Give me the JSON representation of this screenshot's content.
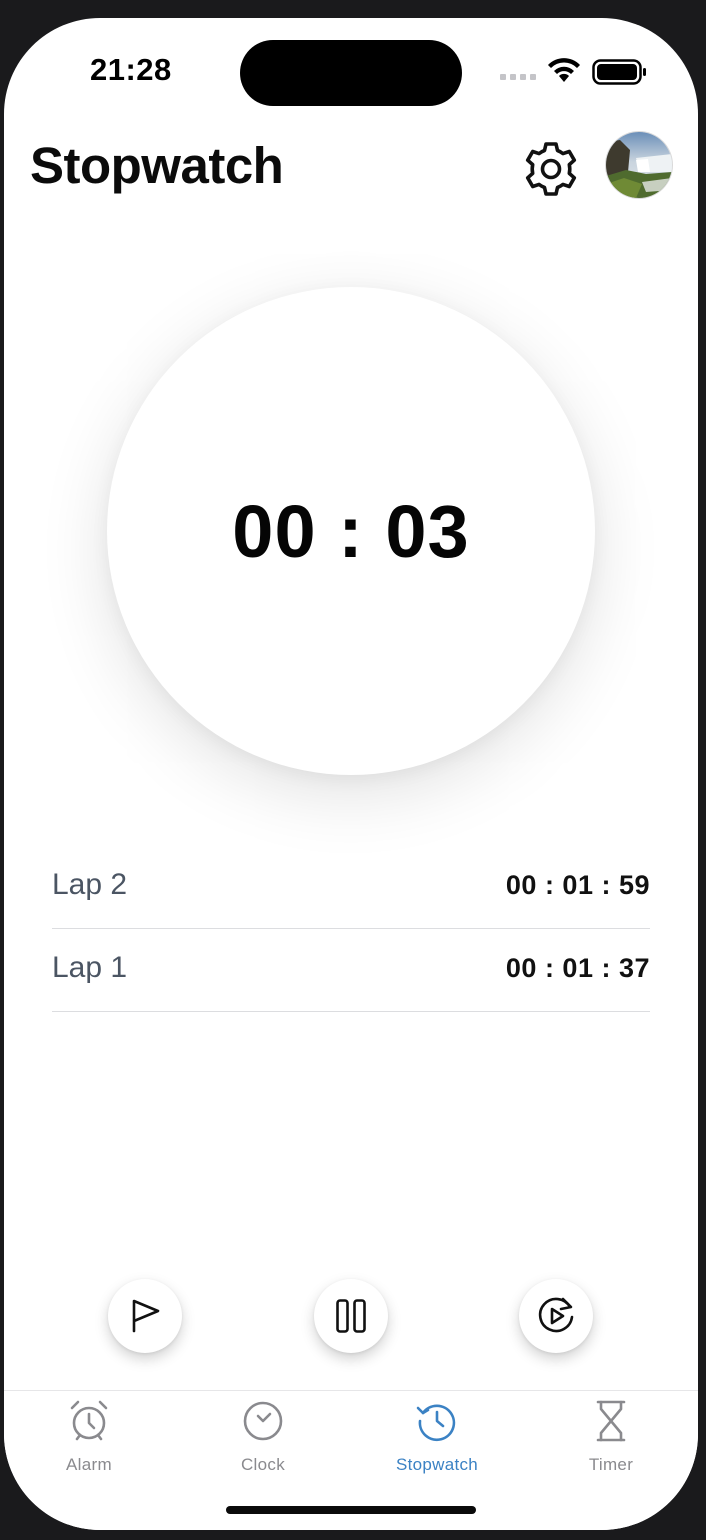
{
  "status_bar": {
    "time": "21:28",
    "wifi_icon": "wifi-icon",
    "battery_icon": "battery-icon"
  },
  "header": {
    "title": "Stopwatch",
    "settings_icon": "gear-icon",
    "avatar_icon": "profile-avatar"
  },
  "stopwatch": {
    "elapsed": "00 : 03"
  },
  "laps": [
    {
      "label": "Lap 2",
      "time": "00 : 01 : 59"
    },
    {
      "label": "Lap 1",
      "time": "00 : 01 : 37"
    }
  ],
  "controls": {
    "lap_icon": "flag-icon",
    "pause_icon": "pause-icon",
    "reset_icon": "replay-icon"
  },
  "tabs": [
    {
      "label": "Alarm",
      "icon": "alarm-clock-icon",
      "active": false
    },
    {
      "label": "Clock",
      "icon": "clock-icon",
      "active": false
    },
    {
      "label": "Stopwatch",
      "icon": "stopwatch-history-icon",
      "active": true
    },
    {
      "label": "Timer",
      "icon": "hourglass-icon",
      "active": false
    }
  ],
  "colors": {
    "accent": "#3b82c4",
    "inactive_tab": "#8a8a8e",
    "text_primary": "#0b0b0b",
    "lap_label": "#4b5563"
  }
}
